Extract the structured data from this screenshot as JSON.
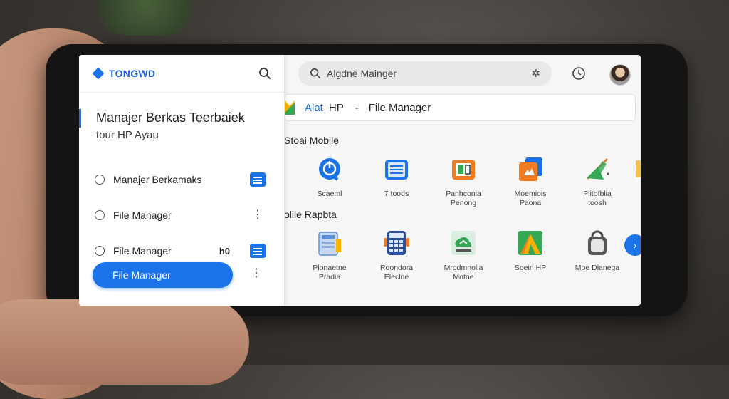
{
  "sidebar": {
    "brand": "TONGWD",
    "title_line1": "Manajer Berkas Teerbaiek",
    "title_line2": "tour HP Ayau",
    "items": [
      {
        "label": "Manajer Berkamaks",
        "extra": "",
        "action": "doc"
      },
      {
        "label": "File Manager",
        "extra": "",
        "action": "kebab"
      },
      {
        "label": "File Manager",
        "extra": "h0",
        "action": "doc"
      }
    ],
    "cta_label": "File Manager"
  },
  "search": {
    "value": "Algdne Mainger"
  },
  "breadcrumb": {
    "part1": "Alat",
    "part2": "HP",
    "separator": "-",
    "part3": "File Manager"
  },
  "sections": {
    "first": "Stoai Mobile",
    "second": "olile Rapbta"
  },
  "apps_row1": [
    {
      "label": "Scaeml",
      "icon": "power-icon",
      "color": "#1a73e8"
    },
    {
      "label": "7 toods",
      "icon": "list-icon",
      "color": "#1a73e8"
    },
    {
      "label": "Panhconia\nPenong",
      "icon": "folder-photo-icon",
      "color": "#f07c22"
    },
    {
      "label": "Moemiois\nPaona",
      "icon": "files-icon",
      "color": "#1a73e8"
    },
    {
      "label": "Plitofblia\ntoosh",
      "icon": "ruler-icon",
      "color": "#34a853"
    }
  ],
  "apps_row2": [
    {
      "label": "Plonaetne\nPradia",
      "icon": "document-icon",
      "color": "#5b8fd9"
    },
    {
      "label": "Roondora\nEleclne",
      "icon": "calculator-icon",
      "color": "#2b4d9e"
    },
    {
      "label": "Mrodmnolia\nMotne",
      "icon": "cloud-icon",
      "color": "#34a853"
    },
    {
      "label": "Soein HP",
      "icon": "triangle-icon",
      "color": "#34a853"
    },
    {
      "label": "Moe Dlanega",
      "icon": "bag-icon",
      "color": "#555555"
    }
  ],
  "next_symbol": "›",
  "kebab": "⋮"
}
